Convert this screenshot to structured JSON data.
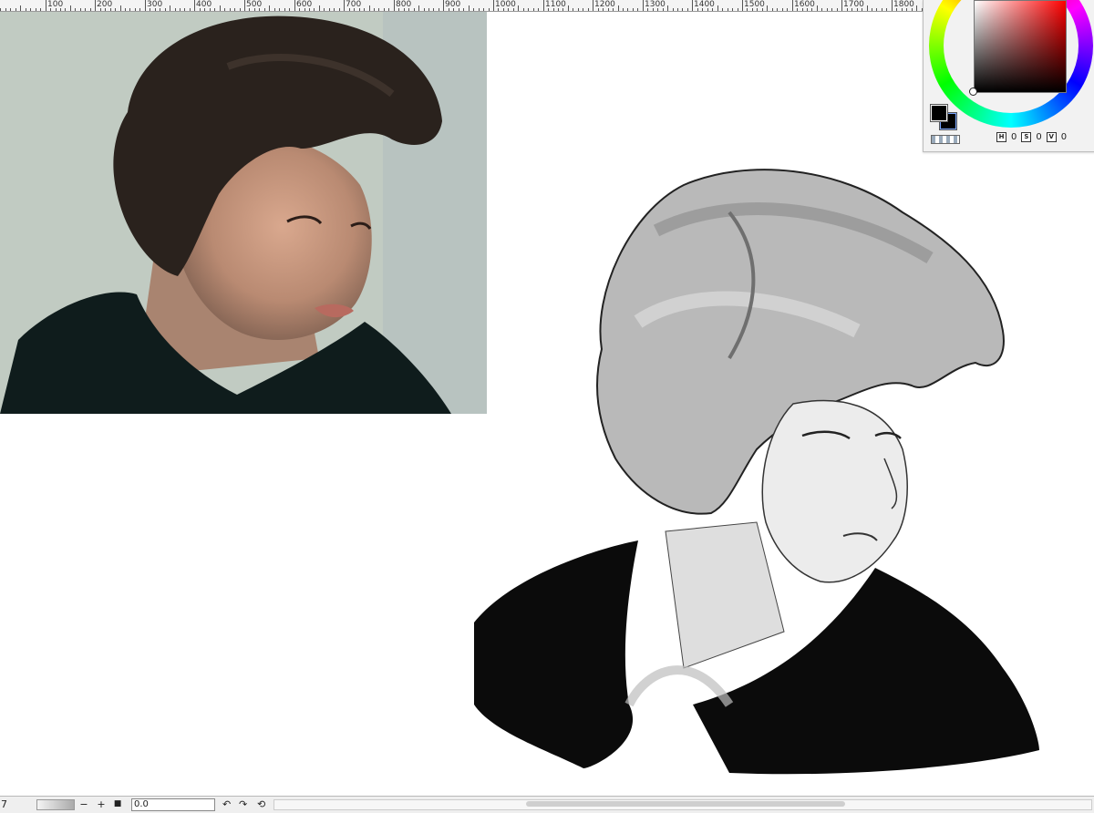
{
  "ruler": {
    "labels": [
      "100",
      "200",
      "300",
      "400",
      "500",
      "600",
      "700",
      "800",
      "900",
      "1000",
      "1100",
      "1200",
      "1300",
      "1400",
      "1500",
      "1600",
      "1700",
      "1800"
    ]
  },
  "color_panel": {
    "foreground_color": "#000000",
    "background_color": "#000000",
    "hue_color": "#ff0000",
    "hsv": {
      "h_key": "H",
      "h_value": "0",
      "s_key": "S",
      "s_value": "0",
      "v_key": "V",
      "v_value": "0"
    }
  },
  "status_bar": {
    "zoom": "7",
    "minus": "−",
    "plus": "+",
    "square": "■",
    "angle": "0.0",
    "rotate_left": "↶",
    "rotate_right": "↷",
    "reset": "⟲"
  }
}
